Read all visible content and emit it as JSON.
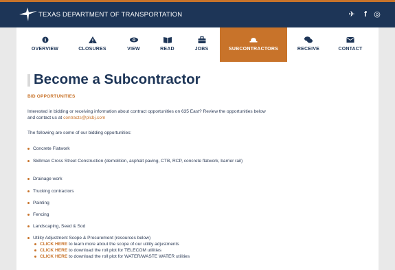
{
  "header": {
    "title": "TEXAS DEPARTMENT OF TRANSPORTATION",
    "social": [
      {
        "name": "twitter-icon",
        "glyph": "✈"
      },
      {
        "name": "facebook-icon",
        "glyph": "f"
      },
      {
        "name": "instagram-icon",
        "glyph": "◎"
      }
    ]
  },
  "nav": {
    "items": [
      {
        "label": "OVERVIEW",
        "icon": "info-icon"
      },
      {
        "label": "CLOSURES",
        "icon": "warning-icon"
      },
      {
        "label": "VIEW",
        "icon": "eye-icon"
      },
      {
        "label": "READ",
        "icon": "book-icon"
      },
      {
        "label": "JOBS",
        "icon": "briefcase-icon"
      },
      {
        "label": "SUBCONTRACTORS",
        "icon": "hardhat-icon",
        "active": true
      },
      {
        "label": "RECEIVE",
        "icon": "chat-icon"
      },
      {
        "label": "CONTACT",
        "icon": "envelope-icon"
      }
    ]
  },
  "main": {
    "title": "Become a Subcontractor",
    "section_label": "BID OPPORTUNITIES",
    "intro_text": "Interested in bidding or receiving information about contract opportunities on 635 East?  Review the opportunities below and contact us at ",
    "intro_email": "contracts@plcbj.com",
    "lead": "The following are some of our bidding opportunities:",
    "bullets": [
      "Concrete Flatwork",
      "Skillman Cross Street Construction (demolition, asphalt paving, CTB, RCP, concrete flatwork, barrier rail)",
      "Drainage work",
      "Trucking contractors",
      "Painting",
      "Fencing",
      "Landscaping, Seed & Sod",
      "Utility Adjustment Scope & Procurement (resources below)"
    ],
    "sub_items": [
      {
        "link": "CLICK HERE",
        "text": " to learn more about the scope of our utility adjustments"
      },
      {
        "link": "CLICK HERE",
        "text": " to download the roll plot for TELECOM utilities"
      },
      {
        "link": "CLICK HERE",
        "text": " to download the roll plot for WATER/WASTE WATER utilities"
      }
    ]
  },
  "colors": {
    "navy": "#1d3557",
    "orange": "#c8732a",
    "text": "#2b3a55"
  }
}
